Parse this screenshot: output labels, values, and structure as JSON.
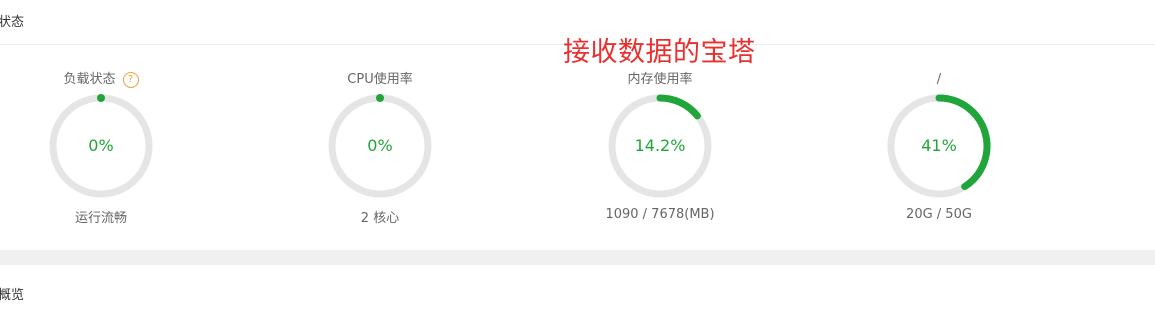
{
  "status_section": {
    "title": "状态"
  },
  "overlay_label": "接收数据的宝塔",
  "gauges": [
    {
      "title": "负载状态",
      "value": "0%",
      "percent": 0,
      "subtitle": "运行流畅",
      "has_help": true
    },
    {
      "title": "CPU使用率",
      "value": "0%",
      "percent": 0,
      "subtitle": "2 核心",
      "has_help": false
    },
    {
      "title": "内存使用率",
      "value": "14.2%",
      "percent": 14.2,
      "subtitle": "1090 / 7678(MB)",
      "has_help": false
    },
    {
      "title": "/",
      "value": "41%",
      "percent": 41,
      "subtitle": "20G / 50G",
      "has_help": false
    }
  ],
  "overview_section": {
    "title": "概览"
  },
  "colors": {
    "accent": "#20a53a",
    "track": "#e5e5e5",
    "overlay": "#ea2f2f",
    "help": "#f0a030"
  }
}
